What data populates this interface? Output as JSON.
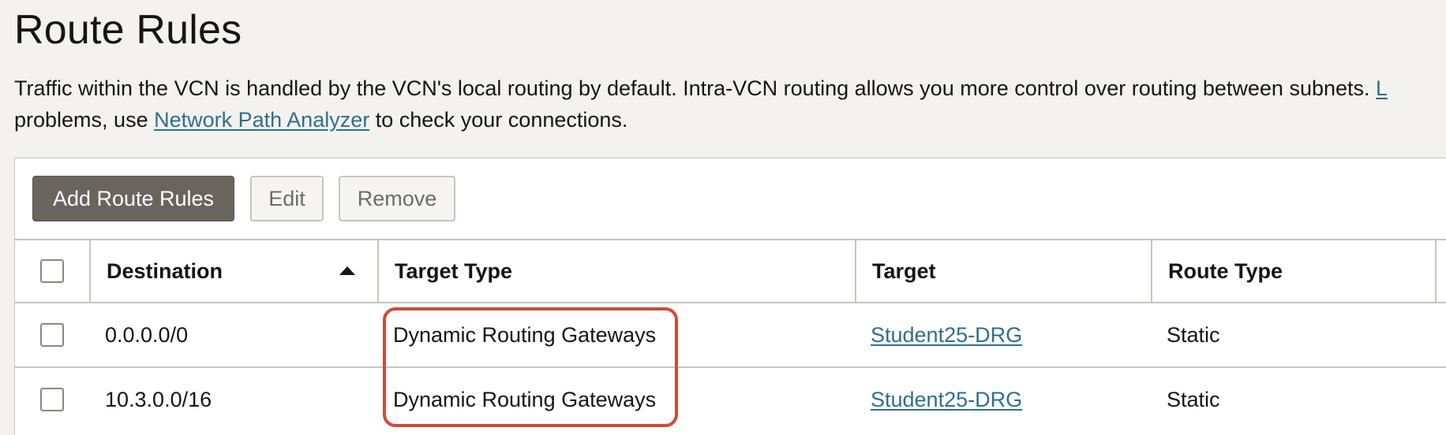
{
  "page": {
    "title": "Route Rules",
    "description_part1": "Traffic within the VCN is handled by the VCN's local routing by default. Intra-VCN routing allows you more control over routing between subnets. ",
    "description_cut_link": "L",
    "description_part2": "problems, use ",
    "description_link": "Network Path Analyzer",
    "description_part3": " to check your connections."
  },
  "toolbar": {
    "add_label": "Add Route Rules",
    "edit_label": "Edit",
    "remove_label": "Remove"
  },
  "table": {
    "columns": [
      "Destination",
      "Target Type",
      "Target",
      "Route Type"
    ],
    "sort_icon": "sort-ascending-icon",
    "rows": [
      {
        "destination": "0.0.0.0/0",
        "target_type": "Dynamic Routing Gateways",
        "target": "Student25-DRG",
        "route_type": "Static"
      },
      {
        "destination": "10.3.0.0/16",
        "target_type": "Dynamic Routing Gateways",
        "target": "Student25-DRG",
        "route_type": "Static"
      }
    ]
  },
  "colors": {
    "background": "#f4f2ef",
    "primary_button": "#6a645e",
    "link": "#2e6f8e",
    "highlight": "#d24a36"
  }
}
